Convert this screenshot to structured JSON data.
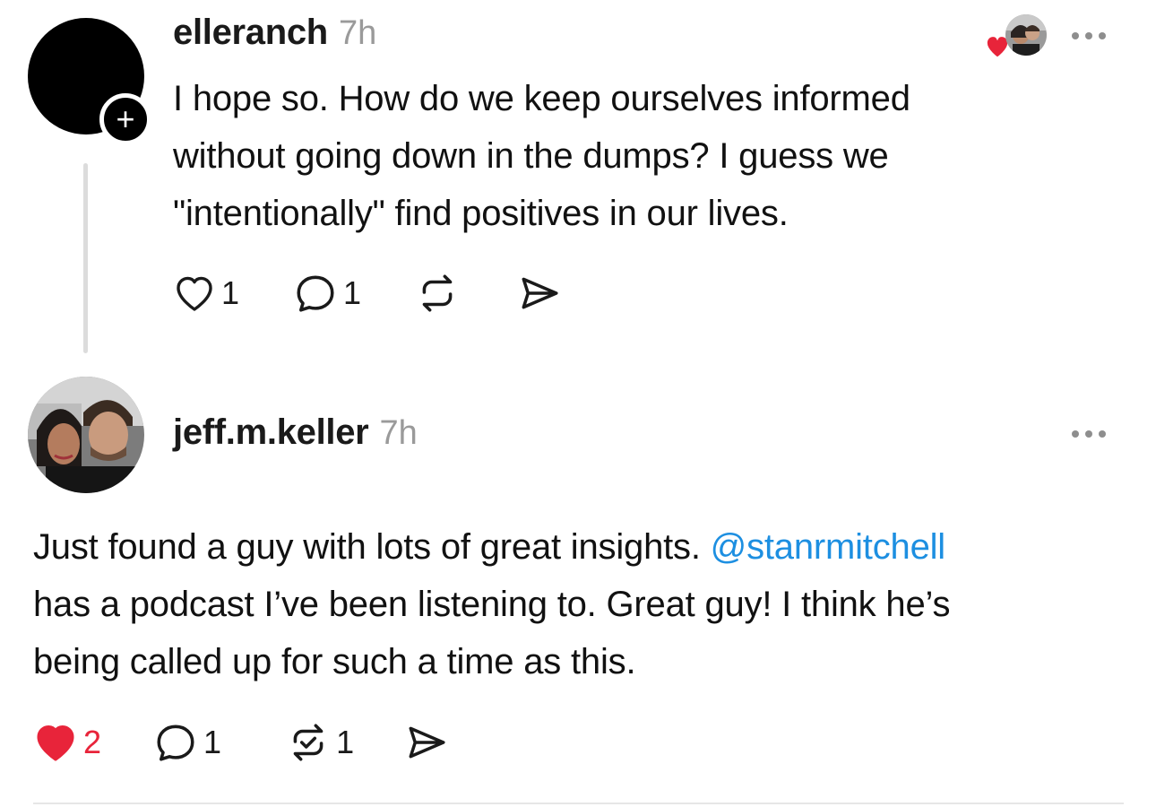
{
  "posts": [
    {
      "username": "elleranch",
      "time": "7h",
      "text_lines": [
        "I hope so. How do we keep ourselves informed",
        "without going down in the dumps? I guess we",
        "\"intentionally\" find positives in our lives."
      ],
      "likes": "1",
      "replies": "1",
      "avatar": "black-avatar",
      "follow_icon": "+"
    },
    {
      "username": "jeff.m.keller",
      "time": "7h",
      "text_line1_before": "Just found a guy with lots of great insights. ",
      "mention": "@stanrmitchell",
      "text_line2": "has a podcast I’ve been listening to. Great guy! I think he’s",
      "text_line3": "being called up for such a time as this.",
      "likes": "2",
      "replies": "1",
      "reposts": "1",
      "liked": true
    }
  ],
  "colors": {
    "like_red": "#e8243a",
    "mention_blue": "#1d8fe1",
    "muted_gray": "#9a9a9a"
  }
}
